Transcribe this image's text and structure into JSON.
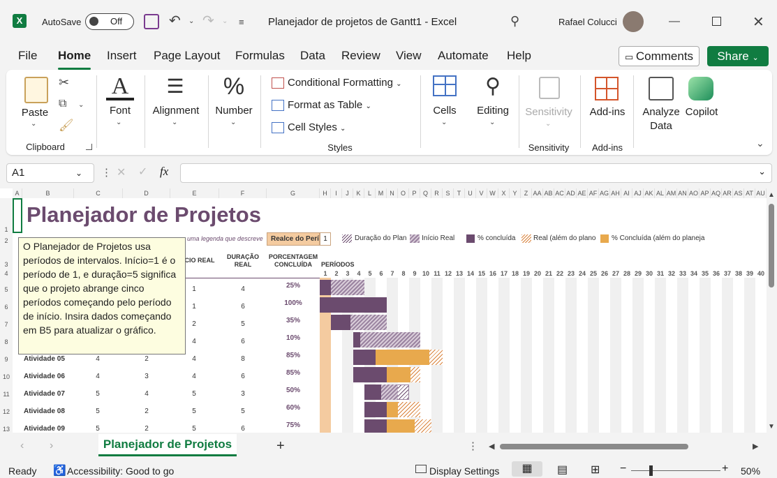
{
  "titlebar": {
    "autosave_label": "AutoSave",
    "autosave_state": "Off",
    "doc_title": "Planejador de projetos de Gantt1  -  Excel",
    "user_name": "Rafael Colucci"
  },
  "tabs": [
    "File",
    "Home",
    "Insert",
    "Page Layout",
    "Formulas",
    "Data",
    "Review",
    "View",
    "Automate",
    "Help"
  ],
  "buttons": {
    "comments": "Comments",
    "share": "Share"
  },
  "ribbon": {
    "paste": "Paste",
    "clipboard": "Clipboard",
    "font": "Font",
    "alignment": "Alignment",
    "number": "Number",
    "conditional_formatting": "Conditional Formatting",
    "format_as_table": "Format as Table",
    "cell_styles": "Cell Styles",
    "styles": "Styles",
    "cells": "Cells",
    "editing": "Editing",
    "sensitivity": "Sensitivity",
    "sensitivity_group": "Sensitivity",
    "addins": "Add-ins",
    "addins_group": "Add-ins",
    "analyze_line1": "Analyze",
    "analyze_line2": "Data",
    "copilot": "Copilot"
  },
  "formula_bar": {
    "name_box": "A1",
    "fx": "fx"
  },
  "columns": [
    "A",
    "B",
    "C",
    "D",
    "E",
    "F",
    "G",
    "H",
    "I",
    "J",
    "K",
    "L",
    "M",
    "N",
    "O",
    "P",
    "Q",
    "R",
    "S",
    "T",
    "U",
    "V",
    "W",
    "X",
    "Y",
    "Z",
    "AA",
    "AB",
    "AC",
    "AD",
    "AE",
    "AF",
    "AG",
    "AH",
    "AI",
    "AJ",
    "AK",
    "AL",
    "AM",
    "AN",
    "AO",
    "AP",
    "AQ",
    "AR",
    "AS",
    "AT",
    "AU"
  ],
  "sheet": {
    "title": "Planejador de Projetos",
    "subtitle_fragment": "uma legenda que descreve",
    "highlight_label": "Realce do Perío",
    "highlight_value": "1",
    "legend": {
      "plan_duration": "Duração do Plan",
      "actual_start": "Início Real",
      "pct_complete": "% concluída",
      "actual_beyond": "Real (além do plano",
      "pct_beyond": "% Concluída (além do planeja"
    },
    "headers": {
      "actual_start": "ÍCIO REAL",
      "actual_duration_1": "DURAÇÃO",
      "actual_duration_2": "REAL",
      "pct_1": "PORCENTAGEM",
      "pct_2": "CONCLUÍDA",
      "periods": "PERÍODOS"
    },
    "rows": [
      {
        "row": "5",
        "activity": "",
        "plan_start": "",
        "plan_dur": "",
        "actual_start": "1",
        "actual_dur": "4",
        "pct": "25%"
      },
      {
        "row": "6",
        "activity": "",
        "plan_start": "",
        "plan_dur": "",
        "actual_start": "1",
        "actual_dur": "6",
        "pct": "100%"
      },
      {
        "row": "7",
        "activity": "",
        "plan_start": "",
        "plan_dur": "",
        "actual_start": "2",
        "actual_dur": "5",
        "pct": "35%"
      },
      {
        "row": "8",
        "activity": "",
        "plan_start": "",
        "plan_dur": "",
        "actual_start": "4",
        "actual_dur": "6",
        "pct": "10%"
      },
      {
        "row": "9",
        "activity": "Atividade 05",
        "plan_start": "4",
        "plan_dur": "2",
        "actual_start": "4",
        "actual_dur": "8",
        "pct": "85%"
      },
      {
        "row": "10",
        "activity": "Atividade 06",
        "plan_start": "4",
        "plan_dur": "3",
        "actual_start": "4",
        "actual_dur": "6",
        "pct": "85%"
      },
      {
        "row": "11",
        "activity": "Atividade 07",
        "plan_start": "5",
        "plan_dur": "4",
        "actual_start": "5",
        "actual_dur": "3",
        "pct": "50%"
      },
      {
        "row": "12",
        "activity": "Atividade 08",
        "plan_start": "5",
        "plan_dur": "2",
        "actual_start": "5",
        "actual_dur": "5",
        "pct": "60%"
      },
      {
        "row": "13",
        "activity": "Atividade 09",
        "plan_start": "5",
        "plan_dur": "2",
        "actual_start": "5",
        "actual_dur": "6",
        "pct": "75%"
      }
    ],
    "periods": [
      "1",
      "2",
      "3",
      "4",
      "5",
      "6",
      "7",
      "8",
      "9",
      "10",
      "11",
      "12",
      "13",
      "14",
      "15",
      "16",
      "17",
      "18",
      "19",
      "20",
      "21",
      "22",
      "23",
      "24",
      "25",
      "26",
      "27",
      "28",
      "29",
      "30",
      "31",
      "32",
      "33",
      "34",
      "35",
      "36",
      "37",
      "38",
      "39",
      "40"
    ]
  },
  "tooltip": "O Planejador de Projetos usa períodos de intervalos. Início=1 é o período de 1, e duração=5 significa que o projeto abrange cinco períodos começando pelo período de início. Insira dados começando em B5 para atualizar o gráfico.",
  "sheet_tab": "Planejador de Projetos",
  "statusbar": {
    "ready": "Ready",
    "accessibility": "Accessibility: Good to go",
    "display_settings": "Display Settings",
    "zoom": "50%"
  },
  "colors": {
    "accent": "#107c41",
    "gantt_plan": "#6b4b6e",
    "gantt_over": "#e8a94d",
    "title": "#6b4b6e"
  }
}
